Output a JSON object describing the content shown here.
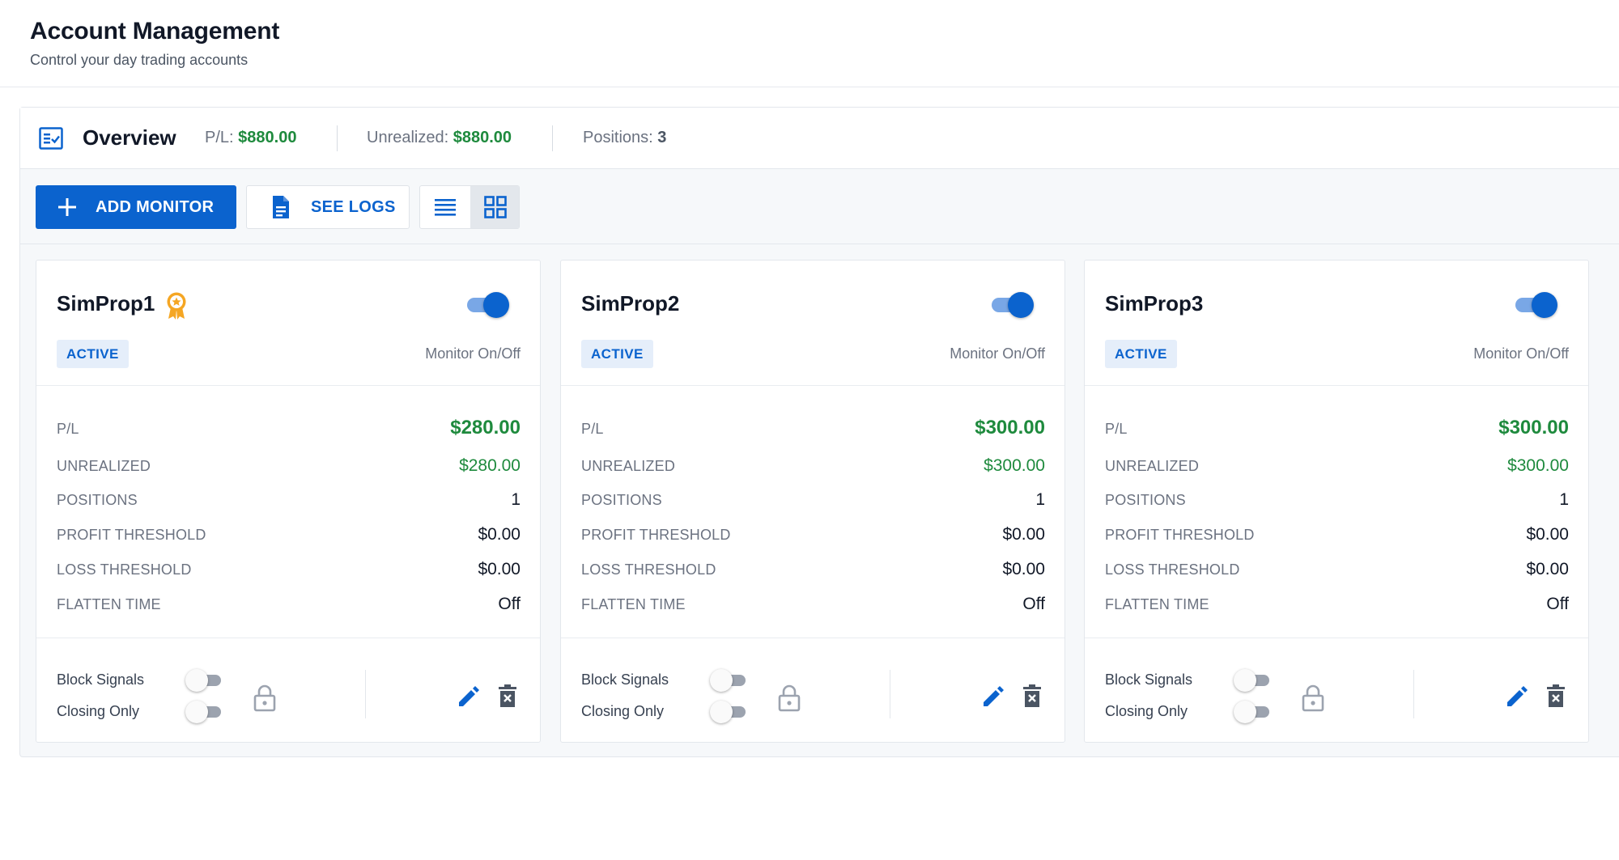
{
  "header": {
    "title": "Account Management",
    "subtitle": "Control your day trading accounts"
  },
  "overview": {
    "title": "Overview",
    "pl_label": "P/L:",
    "pl_value": "$880.00",
    "unrealized_label": "Unrealized:",
    "unrealized_value": "$880.00",
    "positions_label": "Positions:",
    "positions_value": "3"
  },
  "toolbar": {
    "add_label": "ADD MONITOR",
    "logs_label": "SEE LOGS",
    "view_mode": "grid"
  },
  "labels": {
    "monitor": "Monitor On/Off",
    "pl": "P/L",
    "unrealized": "UNREALIZED",
    "positions": "POSITIONS",
    "profit_threshold": "PROFIT THRESHOLD",
    "loss_threshold": "LOSS THRESHOLD",
    "flatten_time": "FLATTEN TIME",
    "block_signals": "Block Signals",
    "closing_only": "Closing Only"
  },
  "colors": {
    "accent": "#0b63ce",
    "profit": "#1e8a3d",
    "award": "#f5a623"
  },
  "accounts": [
    {
      "name": "SimProp1",
      "award": true,
      "status": "ACTIVE",
      "monitor_on": true,
      "pl": "$280.00",
      "unrealized": "$280.00",
      "positions": "1",
      "profit_threshold": "$0.00",
      "loss_threshold": "$0.00",
      "flatten_time": "Off",
      "block_signals": false,
      "closing_only": false
    },
    {
      "name": "SimProp2",
      "award": false,
      "status": "ACTIVE",
      "monitor_on": true,
      "pl": "$300.00",
      "unrealized": "$300.00",
      "positions": "1",
      "profit_threshold": "$0.00",
      "loss_threshold": "$0.00",
      "flatten_time": "Off",
      "block_signals": false,
      "closing_only": false
    },
    {
      "name": "SimProp3",
      "award": false,
      "status": "ACTIVE",
      "monitor_on": true,
      "pl": "$300.00",
      "unrealized": "$300.00",
      "positions": "1",
      "profit_threshold": "$0.00",
      "loss_threshold": "$0.00",
      "flatten_time": "Off",
      "block_signals": false,
      "closing_only": false
    }
  ]
}
